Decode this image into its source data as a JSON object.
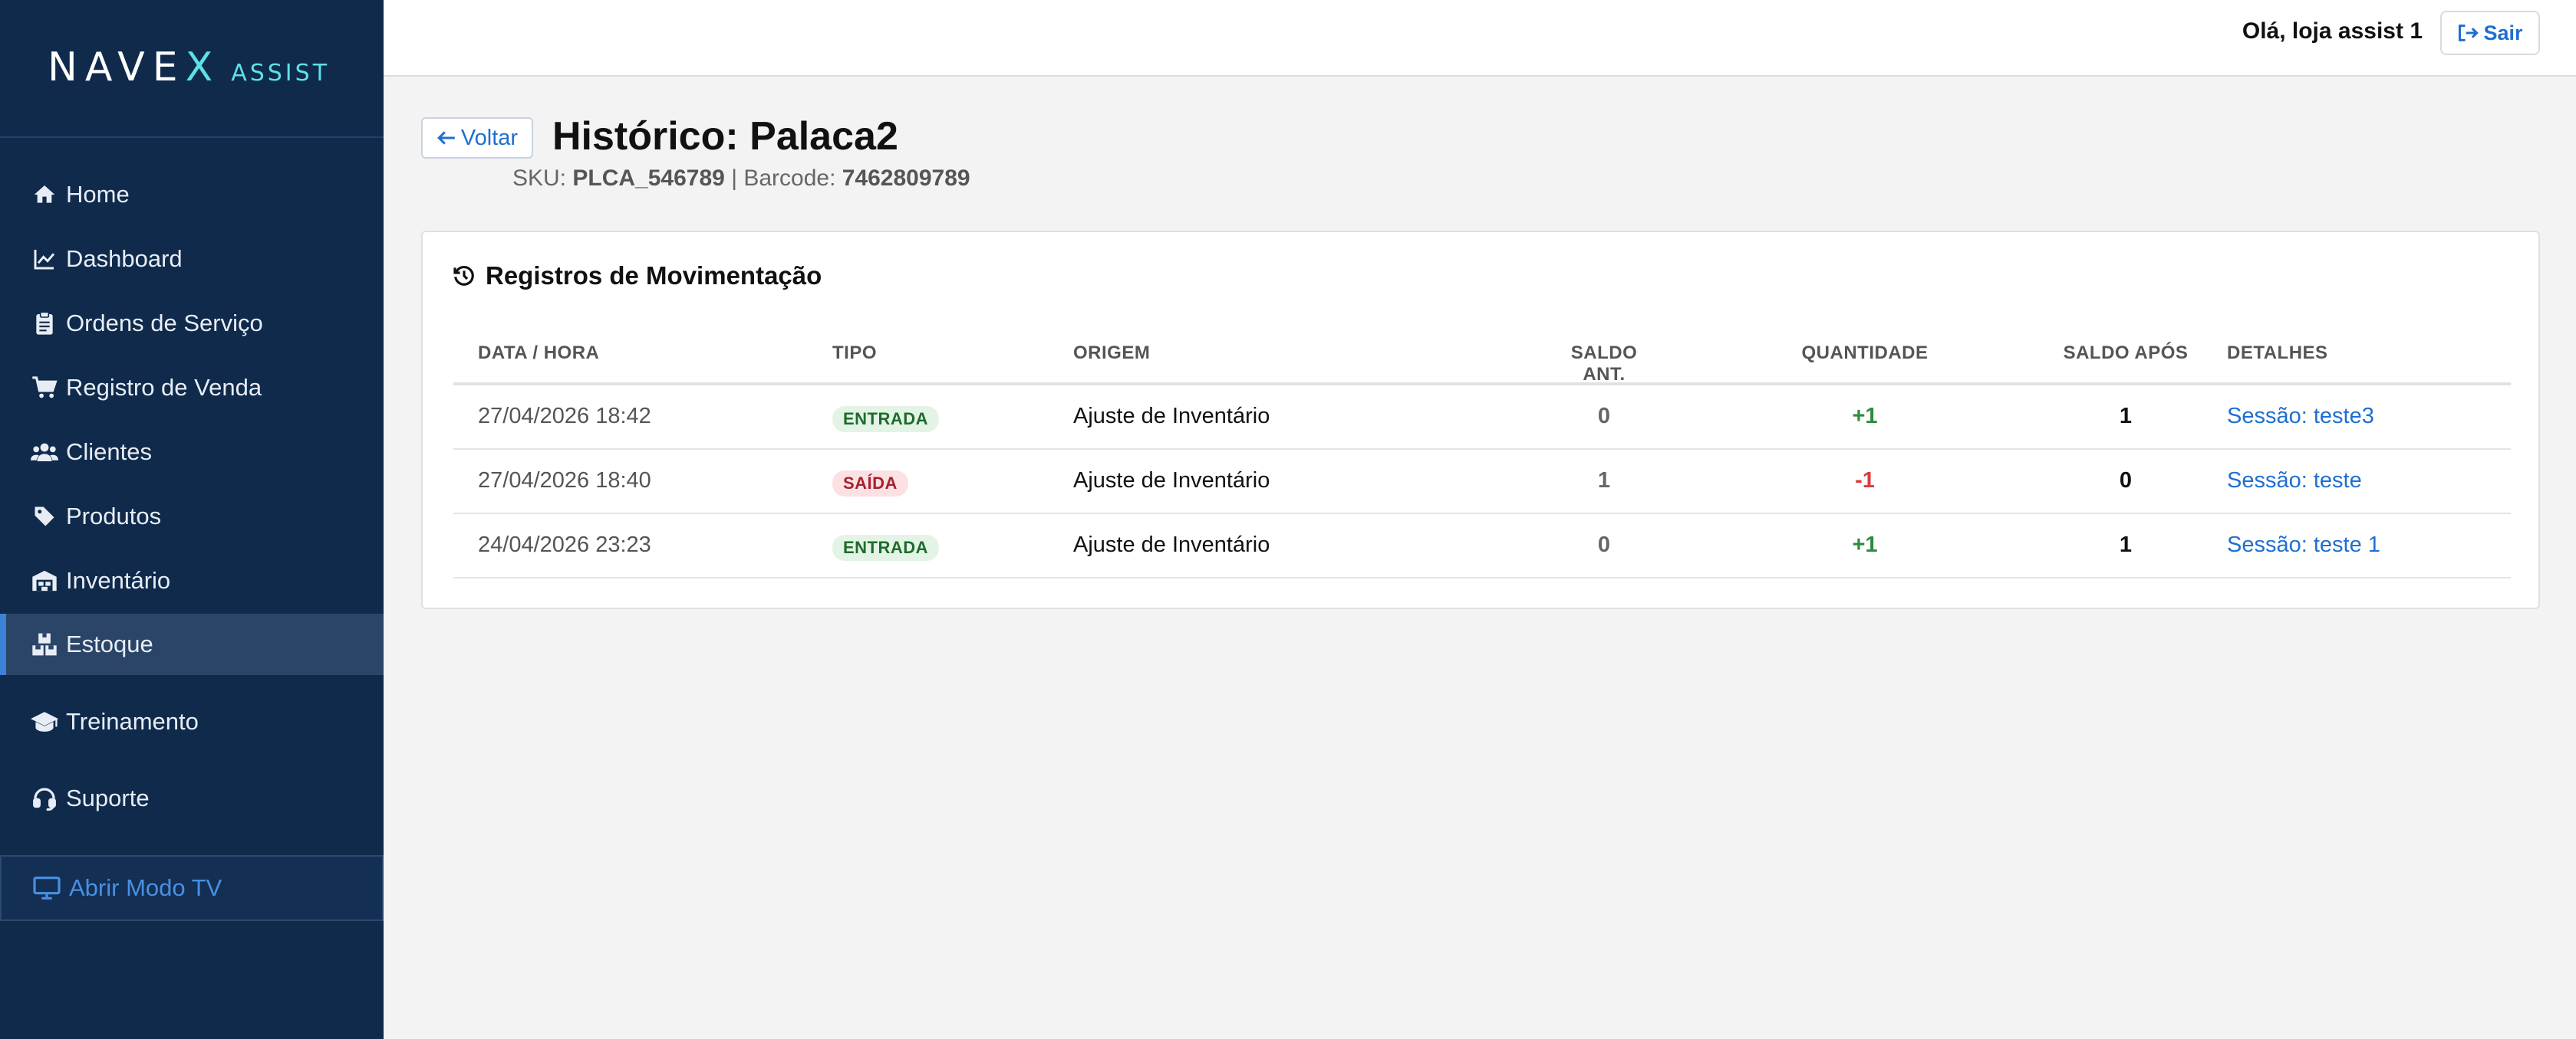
{
  "brand": {
    "name_prefix": "NAVE",
    "name_x": "X",
    "sub": "ASSIST"
  },
  "sidebar": {
    "items": [
      {
        "label": "Home",
        "icon": "home-icon"
      },
      {
        "label": "Dashboard",
        "icon": "chart-line-icon"
      },
      {
        "label": "Ordens de Serviço",
        "icon": "clipboard-icon"
      },
      {
        "label": "Registro de Venda",
        "icon": "cart-icon"
      },
      {
        "label": "Clientes",
        "icon": "users-icon"
      },
      {
        "label": "Produtos",
        "icon": "tag-icon"
      },
      {
        "label": "Inventário",
        "icon": "warehouse-icon"
      },
      {
        "label": "Estoque",
        "icon": "boxes-icon",
        "active": true
      },
      {
        "label": "Treinamento",
        "icon": "graduation-cap-icon"
      },
      {
        "label": "Suporte",
        "icon": "headset-icon"
      }
    ],
    "tv_button": "Abrir Modo TV"
  },
  "header": {
    "greeting": "Olá, loja assist 1",
    "logout": "Sair"
  },
  "page": {
    "back": "Voltar",
    "title": "Histórico: Palaca2",
    "sku_label": "SKU:",
    "sku": "PLCA_546789",
    "separator": "|",
    "barcode_label": "Barcode:",
    "barcode": "7462809789"
  },
  "card": {
    "title": "Registros de Movimentação",
    "columns": [
      "DATA / HORA",
      "TIPO",
      "ORIGEM",
      "SALDO ANT.",
      "QUANTIDADE",
      "SALDO APÓS",
      "DETALHES"
    ],
    "rows": [
      {
        "date": "27/04/2026 18:42",
        "type": "ENTRADA",
        "origin": "Ajuste de Inventário",
        "before": "0",
        "qty": "+1",
        "after": "1",
        "details": "Sessão: teste3"
      },
      {
        "date": "27/04/2026 18:40",
        "type": "SAÍDA",
        "origin": "Ajuste de Inventário",
        "before": "1",
        "qty": "-1",
        "after": "0",
        "details": "Sessão: teste"
      },
      {
        "date": "24/04/2026 23:23",
        "type": "ENTRADA",
        "origin": "Ajuste de Inventário",
        "before": "0",
        "qty": "+1",
        "after": "1",
        "details": "Sessão: teste 1"
      }
    ]
  },
  "colors": {
    "sidebar_bg": "#0f2a4b",
    "accent": "#1f6fd0",
    "brand_accent": "#5ee0e6",
    "positive": "#2e8b3e",
    "negative": "#d93b3b"
  }
}
